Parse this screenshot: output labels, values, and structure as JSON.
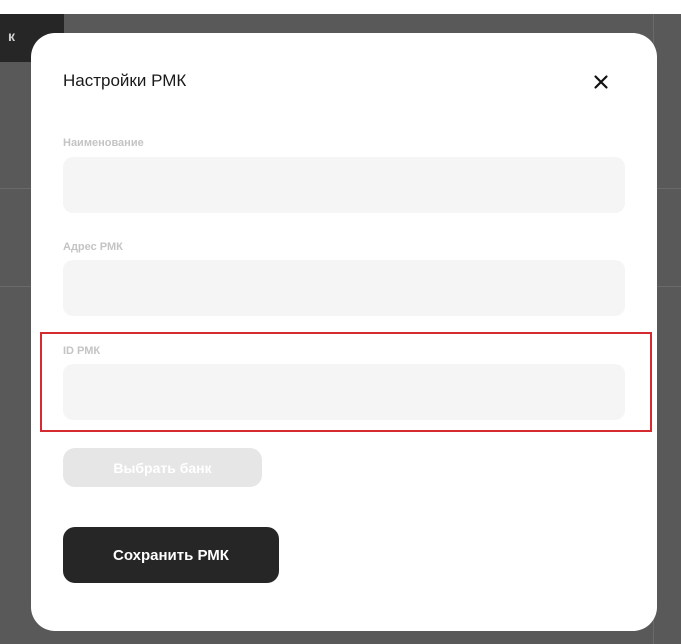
{
  "background": {
    "chip_text": "к"
  },
  "modal": {
    "title": "Настройки РМК",
    "close_icon": "close-icon",
    "fields": [
      {
        "label": "Наименование",
        "value": "",
        "placeholder": ""
      },
      {
        "label": "Адрес РМК",
        "value": "",
        "placeholder": ""
      },
      {
        "label": "ID РМК",
        "value": "",
        "placeholder": ""
      }
    ],
    "select_bank_label": "Выбрать банк",
    "select_bank_disabled": true,
    "save_label": "Сохранить РМК"
  },
  "colors": {
    "backdrop": "#595959",
    "primary_button": "#262626",
    "disabled_button": "#e6e6e6",
    "input_background": "#f5f5f5",
    "highlight": "#d42a30"
  }
}
